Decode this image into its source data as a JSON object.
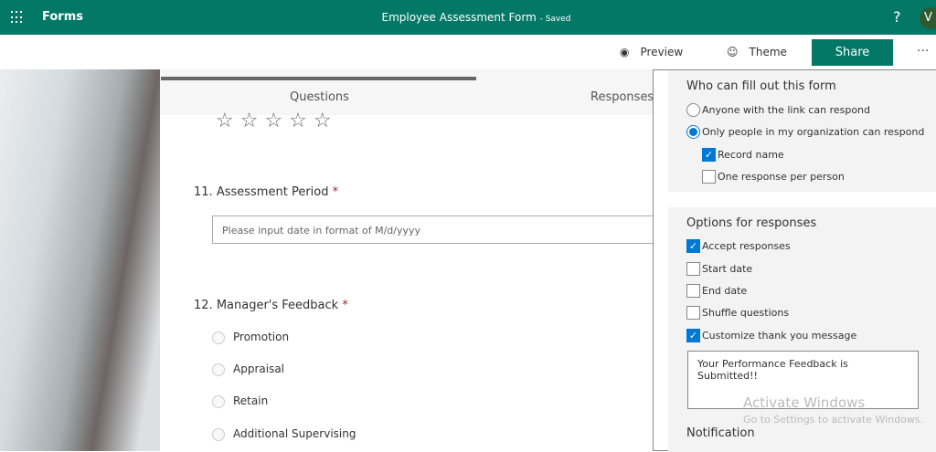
{
  "app": {
    "name": "Forms",
    "form_title": "Employee Assessment Form",
    "save_status": "- Saved",
    "help": "?",
    "avatar": "V"
  },
  "toolbar": {
    "preview": "Preview",
    "theme": "Theme",
    "share": "Share",
    "more": "···"
  },
  "tabs": {
    "questions": "Questions",
    "responses": "Responses"
  },
  "rating_stars": "☆☆☆☆☆",
  "questions": [
    {
      "number": "11.",
      "title": "Assessment Period",
      "required": "*",
      "placeholder": "Please input date in format of M/d/yyyy"
    },
    {
      "number": "12.",
      "title": "Manager's Feedback",
      "required": "*",
      "options": [
        "Promotion",
        "Appraisal",
        "Retain",
        "Additional Supervising"
      ]
    }
  ],
  "settings": {
    "who_title": "Who can fill out this form",
    "who_options": [
      {
        "label": "Anyone with the link can respond",
        "selected": false
      },
      {
        "label": "Only people in my organization can respond",
        "selected": true
      }
    ],
    "org_options": [
      {
        "label": "Record name",
        "checked": true
      },
      {
        "label": "One response per person",
        "checked": false
      }
    ],
    "responses_title": "Options for responses",
    "response_options": [
      {
        "label": "Accept responses",
        "checked": true
      },
      {
        "label": "Start date",
        "checked": false
      },
      {
        "label": "End date",
        "checked": false
      },
      {
        "label": "Shuffle questions",
        "checked": false
      },
      {
        "label": "Customize thank you message",
        "checked": true
      }
    ],
    "thank_you_message": "Your Performance Feedback is Submitted!!",
    "notification_title": "Notification"
  },
  "watermark": {
    "line1": "Activate Windows",
    "line2": "Go to Settings to activate Windows."
  }
}
